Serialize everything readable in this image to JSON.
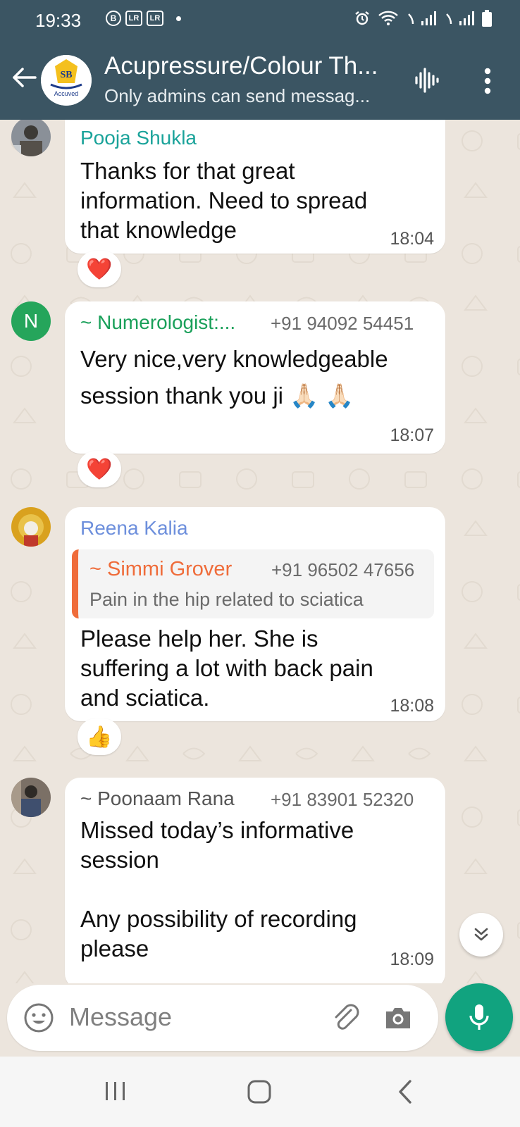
{
  "status_bar": {
    "time": "19:33",
    "badges": [
      "B",
      "LR",
      "LR"
    ]
  },
  "header": {
    "title": "Acupressure/Colour Th...",
    "subtitle": "Only admins can send messag...",
    "avatar_text": "Accuved"
  },
  "messages": [
    {
      "sender": "Pooja Shukla",
      "sender_color": "#1aa39a",
      "text": "Thanks for that great\ninformation. Need to spread\nthat knowledge",
      "time": "18:04",
      "reaction": "❤️"
    },
    {
      "sender": "~ Numerologist:...",
      "sender_color": "#1aa05a",
      "phone": "+91 94092 54451",
      "avatar_letter": "N",
      "text": "Very nice,very knowledgeable\nsession thank you ji 🙏🏻 🙏🏻",
      "time": "18:07",
      "reaction": "❤️"
    },
    {
      "sender": "Reena Kalia",
      "sender_color": "#6d8fdc",
      "quote": {
        "sender": "~ Simmi Grover",
        "sender_color": "#ef6c3a",
        "phone": "+91 96502 47656",
        "text": "Pain in the hip related to sciatica"
      },
      "text": "Please help her. She is\nsuffering a lot with back pain\nand sciatica.",
      "time": "18:08",
      "reaction": "👍"
    },
    {
      "sender": "~ Poonaam Rana",
      "sender_color": "#555555",
      "phone": "+91 83901 52320",
      "text": "Missed today’s informative\nsession\n\nAny possibility of recording\nplease",
      "time": "18:09"
    }
  ],
  "input": {
    "placeholder": "Message"
  },
  "colors": {
    "header_bg": "#3b5563",
    "chat_bg": "#ece5dd",
    "accent": "#11a37f"
  }
}
